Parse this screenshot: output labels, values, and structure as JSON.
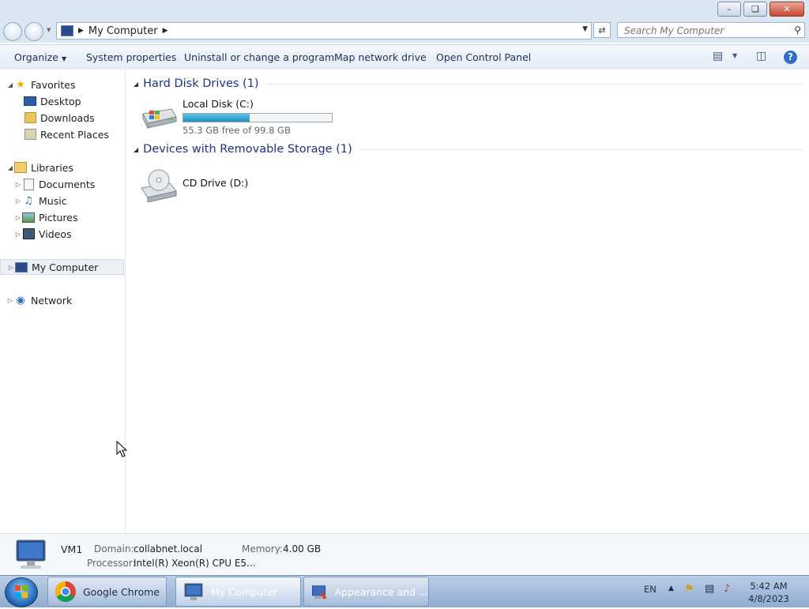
{
  "window": {
    "controls": [
      "minimize",
      "maximize",
      "close"
    ]
  },
  "address": {
    "path": "My Computer",
    "search_placeholder": "Search My Computer"
  },
  "toolbar": {
    "organize": "Organize",
    "system_properties": "System properties",
    "uninstall": "Uninstall or change a program",
    "map_drive": "Map network drive",
    "control_panel": "Open Control Panel"
  },
  "nav": {
    "favorites": "Favorites",
    "desktop": "Desktop",
    "downloads": "Downloads",
    "recent_places": "Recent Places",
    "libraries": "Libraries",
    "documents": "Documents",
    "music": "Music",
    "pictures": "Pictures",
    "videos": "Videos",
    "my_computer": "My Computer",
    "network": "Network"
  },
  "content": {
    "hdd_header": "Hard Disk Drives (1)",
    "removable_header": "Devices with Removable Storage (1)",
    "local_disk": {
      "name": "Local Disk (C:)",
      "free_text": "55.3 GB free of 99.8 GB",
      "used_fraction": 0.446
    },
    "cd_drive": {
      "name": "CD Drive (D:)"
    }
  },
  "details": {
    "name": "VM1",
    "domain_label": "Domain:",
    "domain_value": "collabnet.local",
    "memory_label": "Memory:",
    "memory_value": "4.00 GB",
    "processor_label": "Processor:",
    "processor_value": "Intel(R) Xeon(R) CPU E5..."
  },
  "taskbar": {
    "apps": [
      {
        "label": "Google Chrome"
      },
      {
        "label": "My Computer"
      },
      {
        "label": "Appearance and ..."
      }
    ],
    "lang": "EN",
    "time": "5:42 AM",
    "date": "4/8/2023"
  }
}
